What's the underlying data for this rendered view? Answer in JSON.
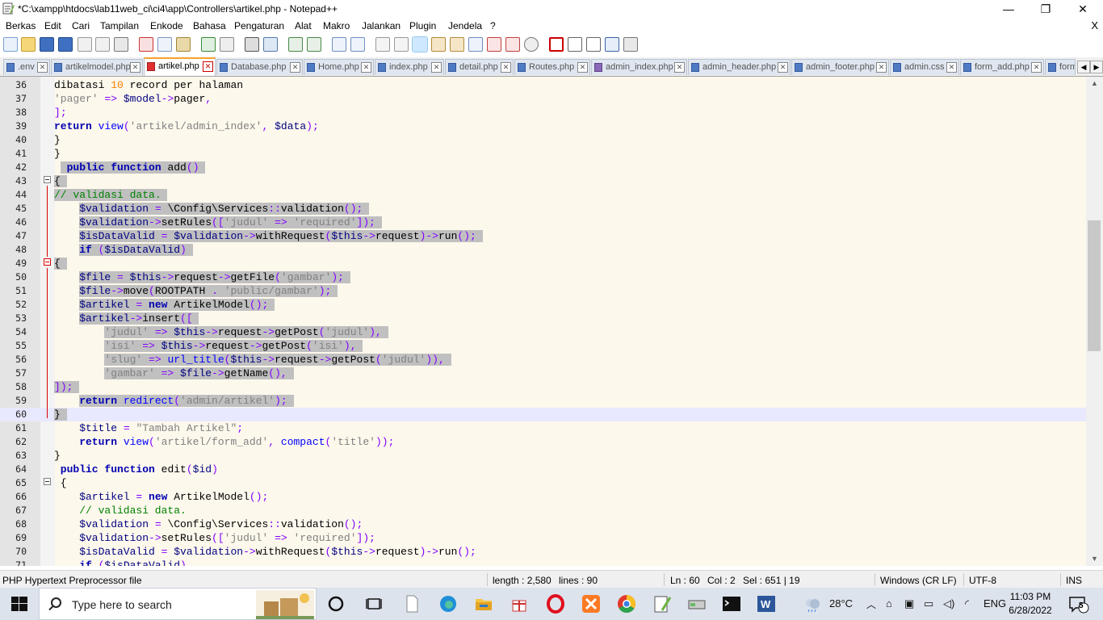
{
  "window": {
    "title": "*C:\\xampp\\htdocs\\lab11web_ci\\ci4\\app\\Controllers\\artikel.php - Notepad++",
    "controls": [
      "—",
      "❐",
      "✕"
    ],
    "menu_close": "X"
  },
  "menu": [
    "Berkas",
    "Edit",
    "Cari",
    "Tampilan",
    "Enkode",
    "Bahasa",
    "Pengaturan",
    "Alat",
    "Makro",
    "Jalankan",
    "Plugin",
    "Jendela",
    "?"
  ],
  "tabs": [
    {
      "label": ".env"
    },
    {
      "label": "artikelmodel.php"
    },
    {
      "label": "artikel.php",
      "active": true
    },
    {
      "label": "Database.php"
    },
    {
      "label": "Home.php"
    },
    {
      "label": "index.php"
    },
    {
      "label": "detail.php"
    },
    {
      "label": "Routes.php"
    },
    {
      "label": "admin_index.php"
    },
    {
      "label": "admin_header.php"
    },
    {
      "label": "admin_footer.php"
    },
    {
      "label": "admin.css"
    },
    {
      "label": "form_add.php"
    },
    {
      "label": "form"
    }
  ],
  "editor": {
    "lines": [
      {
        "n": "36",
        "indent": 0,
        "text": "dibatasi 10 record per halaman",
        "sel": false
      },
      {
        "n": "37",
        "indent": 0,
        "text": "'pager' => $model->pager,",
        "sel": false
      },
      {
        "n": "38",
        "indent": 0,
        "text": "];",
        "sel": false
      },
      {
        "n": "39",
        "indent": 0,
        "text": "return view('artikel/admin_index', $data);",
        "sel": false
      },
      {
        "n": "40",
        "indent": 0,
        "text": "}",
        "sel": false
      },
      {
        "n": "41",
        "indent": 0,
        "text": "}",
        "sel": false
      },
      {
        "n": "42",
        "indent": 2,
        "text": "public function add()",
        "sel": true,
        "lead": true
      },
      {
        "n": "43",
        "indent": 0,
        "text": "{",
        "sel": true
      },
      {
        "n": "44",
        "indent": 0,
        "text": "// validasi data.",
        "sel": true
      },
      {
        "n": "45",
        "indent": 4,
        "text": "$validation = \\Config\\Services::validation();",
        "sel": true
      },
      {
        "n": "46",
        "indent": 4,
        "text": "$validation->setRules(['judul' => 'required']);",
        "sel": true
      },
      {
        "n": "47",
        "indent": 4,
        "text": "$isDataValid = $validation->withRequest($this->request)->run();",
        "sel": true
      },
      {
        "n": "48",
        "indent": 4,
        "text": "if ($isDataValid)",
        "sel": true
      },
      {
        "n": "49",
        "indent": 0,
        "text": "{",
        "sel": true
      },
      {
        "n": "50",
        "indent": 4,
        "text": "$file = $this->request->getFile('gambar');",
        "sel": true
      },
      {
        "n": "51",
        "indent": 4,
        "text": "$file->move(ROOTPATH . 'public/gambar');",
        "sel": true
      },
      {
        "n": "52",
        "indent": 4,
        "text": "$artikel = new ArtikelModel();",
        "sel": true
      },
      {
        "n": "53",
        "indent": 4,
        "text": "$artikel->insert([",
        "sel": true
      },
      {
        "n": "54",
        "indent": 8,
        "text": "'judul' => $this->request->getPost('judul'),",
        "sel": true
      },
      {
        "n": "55",
        "indent": 8,
        "text": "'isi' => $this->request->getPost('isi'),",
        "sel": true
      },
      {
        "n": "56",
        "indent": 8,
        "text": "'slug' => url_title($this->request->getPost('judul')),",
        "sel": true
      },
      {
        "n": "57",
        "indent": 8,
        "text": "'gambar' => $file->getName(),",
        "sel": true
      },
      {
        "n": "58",
        "indent": 0,
        "text": "]);",
        "sel": true
      },
      {
        "n": "59",
        "indent": 4,
        "text": "return redirect('admin/artikel');",
        "sel": true
      },
      {
        "n": "60",
        "indent": 0,
        "text": "}",
        "sel": true,
        "current": true
      },
      {
        "n": "61",
        "indent": 4,
        "text": "$title = \"Tambah Artikel\";",
        "sel": false
      },
      {
        "n": "62",
        "indent": 4,
        "text": "return view('artikel/form_add', compact('title'));",
        "sel": false
      },
      {
        "n": "63",
        "indent": 0,
        "text": "}",
        "sel": false
      },
      {
        "n": "64",
        "indent": 1,
        "text": "public function edit($id)",
        "sel": false
      },
      {
        "n": "65",
        "indent": 1,
        "text": "{",
        "sel": false
      },
      {
        "n": "66",
        "indent": 4,
        "text": "$artikel = new ArtikelModel();",
        "sel": false
      },
      {
        "n": "67",
        "indent": 4,
        "text": "// validasi data.",
        "sel": false
      },
      {
        "n": "68",
        "indent": 4,
        "text": "$validation = \\Config\\Services::validation();",
        "sel": false
      },
      {
        "n": "69",
        "indent": 4,
        "text": "$validation->setRules(['judul' => 'required']);",
        "sel": false
      },
      {
        "n": "70",
        "indent": 4,
        "text": "$isDataValid = $validation->withRequest($this->request)->run();",
        "sel": false
      },
      {
        "n": "71",
        "indent": 4,
        "text": "if ($isDataValid)",
        "sel": false
      }
    ]
  },
  "status": {
    "filetype": "PHP Hypertext Preprocessor file",
    "length": "length : 2,580",
    "lines": "lines : 90",
    "ln": "Ln : 60",
    "col": "Col : 2",
    "sel": "Sel : 651 | 19",
    "eol": "Windows (CR LF)",
    "encoding": "UTF-8",
    "mode": "INS"
  },
  "taskbar": {
    "search_placeholder": "Type here to search",
    "weather": "28°C",
    "language": "ENG",
    "time": "11:03 PM",
    "date": "6/28/2022",
    "notifications": "5"
  },
  "colors": {
    "keyword": "#0000ff",
    "keyword_bold": "#0000b0",
    "variable": "#000080",
    "string": "#808080",
    "number": "#ff8000",
    "comment": "#008000",
    "operator": "#8000ff",
    "selection": "#c0c0c0",
    "editor_bg": "#fdf8ec"
  }
}
